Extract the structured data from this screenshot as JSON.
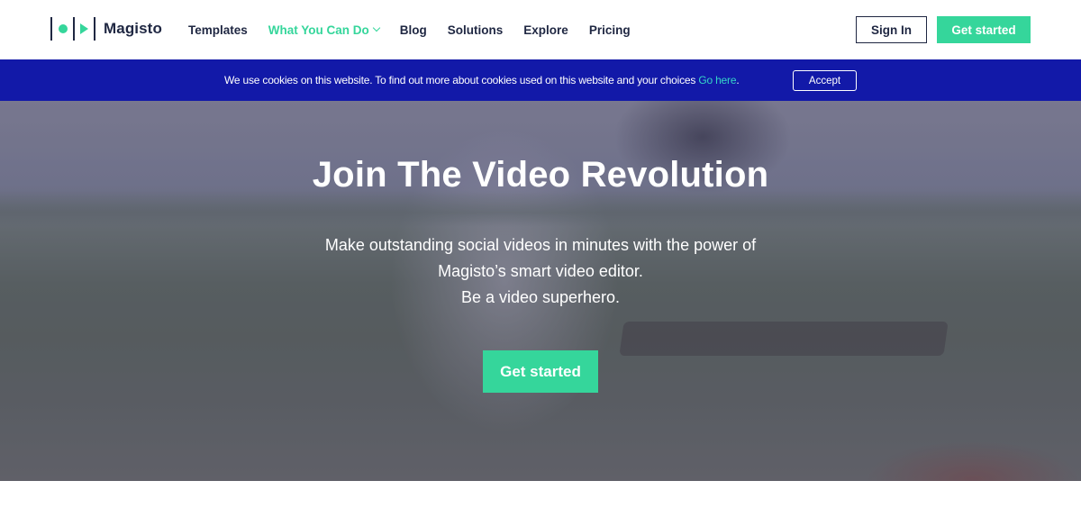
{
  "brand": {
    "name": "Magisto",
    "accent_color": "#35d69b",
    "dark_color": "#1f2742"
  },
  "nav": {
    "items": [
      {
        "label": "Templates",
        "active": false
      },
      {
        "label": "What You Can Do",
        "active": true,
        "icon": "chevron-down-icon"
      },
      {
        "label": "Blog",
        "active": false
      },
      {
        "label": "Solutions",
        "active": false
      },
      {
        "label": "Explore",
        "active": false
      },
      {
        "label": "Pricing",
        "active": false
      }
    ],
    "signin_label": "Sign In",
    "getstarted_label": "Get started"
  },
  "cookie_banner": {
    "text": "We use cookies on this website. To find out more about cookies used on this website and your choices ",
    "link_text": "Go here",
    "trailing": ".",
    "accept_label": "Accept",
    "background": "#1219a8"
  },
  "hero": {
    "title": "Join The Video Revolution",
    "subtitle_lines": [
      "Make outstanding social videos in minutes with the power of",
      "Magisto’s smart video editor.",
      "Be a video superhero."
    ],
    "cta_label": "Get started"
  }
}
